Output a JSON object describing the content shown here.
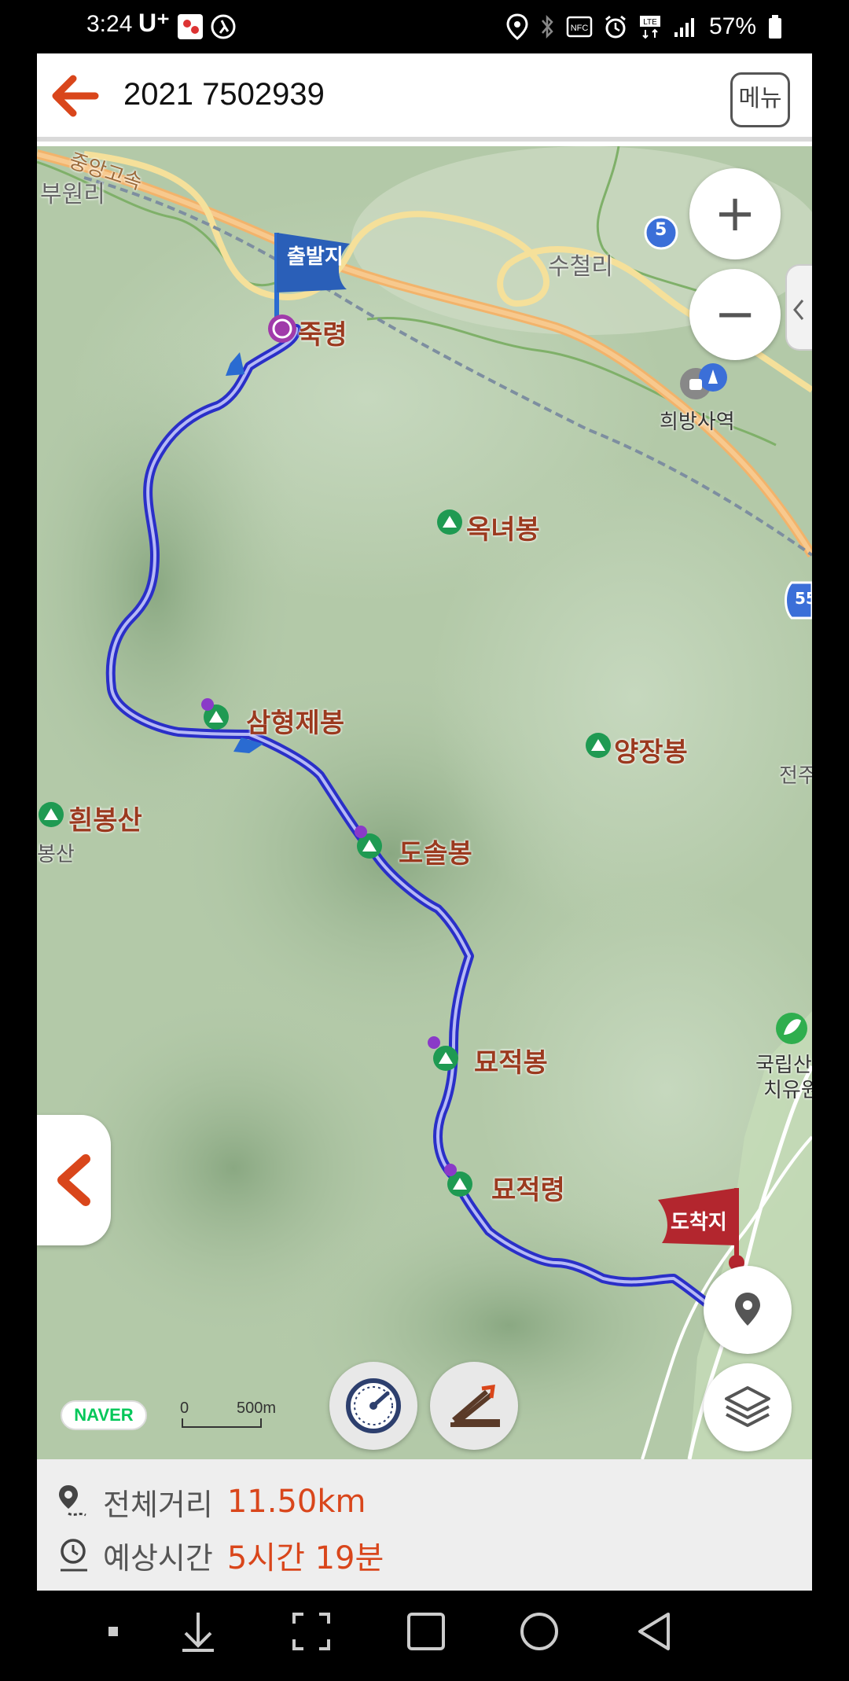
{
  "status_bar": {
    "time": "3:24",
    "carrier": "U⁺",
    "battery": "57%"
  },
  "header": {
    "title": "2021 7502939",
    "menu_label": "메뉴"
  },
  "map": {
    "start_flag": "출발지",
    "end_flag": "도착지",
    "places": {
      "start_pass": "죽령",
      "peak_oknyeo": "옥녀봉",
      "peak_samhyeongje": "삼형제봉",
      "peak_yangjang": "양장봉",
      "peak_huinbong": "흰봉산",
      "peak_huinbong_cut": "봉산",
      "peak_dosol": "도솔봉",
      "peak_myojeok": "묘적봉",
      "pass_myojeok": "묘적령",
      "village_sucheol": "수철리",
      "village_buwon": "부원리",
      "station_huibangsa": "희방사역",
      "expressway": "중앙고속",
      "forest_1": "국립산",
      "forest_2": "치유원",
      "edge_label": "전주"
    },
    "road_badge": "5",
    "road_badge_2": "55",
    "zoom_in": "+",
    "zoom_out": "−",
    "naver": "NAVER",
    "scale_zero": "0",
    "scale_length": "500m"
  },
  "info": {
    "distance_label": "전체거리",
    "distance_value": "11.50km",
    "time_label": "예상시간",
    "time_value": "5시간 19분"
  },
  "colors": {
    "accent": "#d9461b",
    "route": "#2a2fc8",
    "start_flag": "#2a6bd1",
    "end_flag": "#b3262e"
  }
}
